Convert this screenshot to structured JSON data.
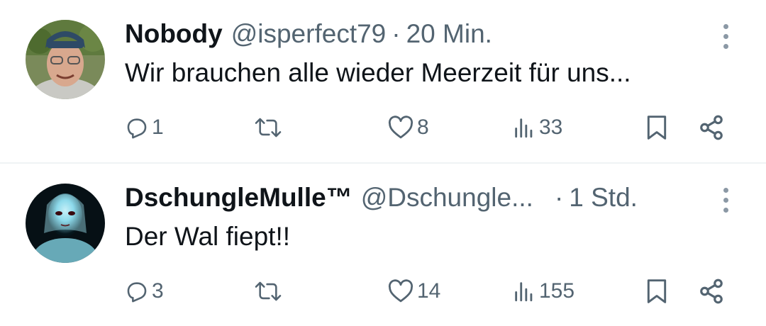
{
  "tweets": [
    {
      "name": "Nobody",
      "handle": "@isperfect79",
      "separator": "·",
      "time": "20 Min.",
      "text": "Wir brauchen alle wieder Meerzeit für uns...",
      "replies": "1",
      "retweets": "",
      "likes": "8",
      "views": "33"
    },
    {
      "name": "DschungleMulle™",
      "handle": "@Dschungle...",
      "separator": "·",
      "time": "1 Std.",
      "text": "Der Wal fiept!!",
      "replies": "3",
      "retweets": "",
      "likes": "14",
      "views": "155"
    }
  ],
  "icons": {
    "reply": "reply-icon",
    "retweet": "retweet-icon",
    "like": "heart-icon",
    "views": "views-icon",
    "bookmark": "bookmark-icon",
    "share": "share-icon",
    "more": "more-vertical-icon"
  },
  "colors": {
    "text": "#0f1419",
    "secondary": "#536471",
    "divider": "#eff3f4"
  }
}
